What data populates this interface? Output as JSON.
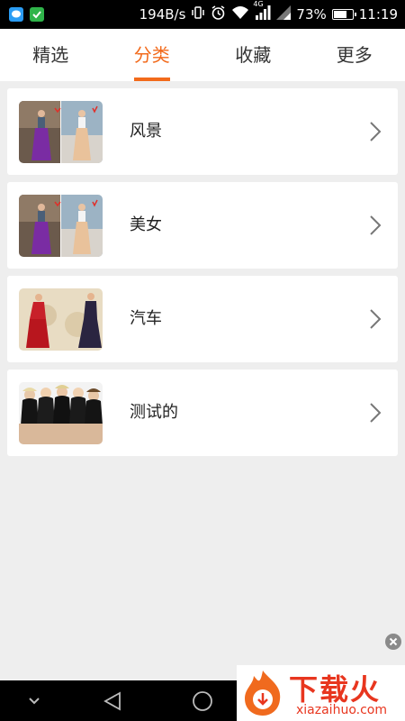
{
  "status_bar": {
    "network_speed": "194B/s",
    "network_type": "4G",
    "battery": "73%",
    "battery_level": 0.73,
    "time": "11:19",
    "icons": [
      "chat-app-icon",
      "wechat-app-icon",
      "vibrate-icon",
      "alarm-icon",
      "wifi-icon",
      "signal-icon",
      "signal-icon-2",
      "battery-icon"
    ]
  },
  "tabs": [
    {
      "label": "精选",
      "active": false
    },
    {
      "label": "分类",
      "active": true
    },
    {
      "label": "收藏",
      "active": false
    },
    {
      "label": "更多",
      "active": false
    }
  ],
  "accent_color": "#f26a1b",
  "categories": [
    {
      "label": "风景"
    },
    {
      "label": "美女"
    },
    {
      "label": "汽车"
    },
    {
      "label": "测试的"
    }
  ],
  "nav_bar": {
    "icons": [
      "chevron-down-icon",
      "back-icon",
      "home-icon"
    ]
  },
  "watermark": {
    "title": "下载火",
    "url": "xiazaihuo.com"
  }
}
